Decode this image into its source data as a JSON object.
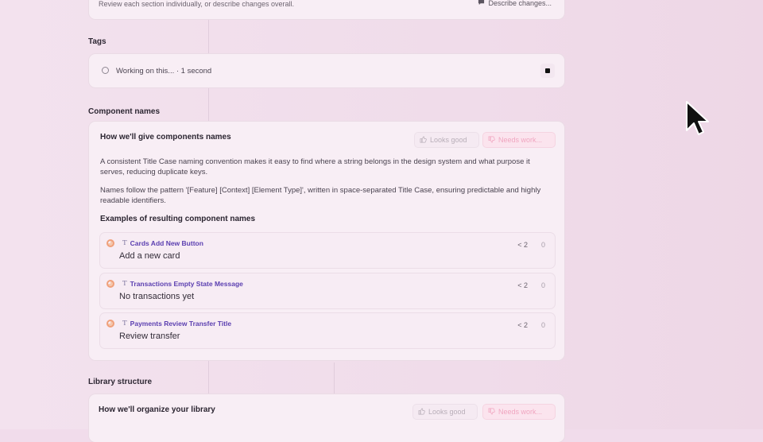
{
  "top_card": {
    "hint": "Review each section individually, or describe changes overall.",
    "describe_label": "Describe changes..."
  },
  "tags": {
    "heading": "Tags",
    "status": "Working on this... · 1 second"
  },
  "component_names": {
    "heading": "Component names",
    "card_title": "How we'll give components names",
    "looks_good": "Looks good",
    "needs_work": "Needs work...",
    "para1": "A consistent Title Case naming convention makes it easy to find where a string belongs in the design system and what purpose it serves, reducing duplicate keys.",
    "para2": "Names follow the pattern '[Feature] [Context] [Element Type]', written in space-separated Title Case, ensuring predictable and highly readable identifiers.",
    "examples_heading": "Examples of resulting component names",
    "examples": [
      {
        "key": "Cards Add New Button",
        "value": "Add a new card",
        "count": "2",
        "zero": "0"
      },
      {
        "key": "Transactions Empty State Message",
        "value": "No transactions yet",
        "count": "2",
        "zero": "0"
      },
      {
        "key": "Payments Review Transfer Title",
        "value": "Review transfer",
        "count": "2",
        "zero": "0"
      }
    ]
  },
  "library": {
    "heading": "Library structure",
    "card_title": "How we'll organize your library",
    "looks_good": "Looks good",
    "needs_work": "Needs work..."
  },
  "colors": {
    "accent_purple": "#5b3fb0",
    "needs_work_pink": "#f0a6c0",
    "icon_orange": "#f0a07a"
  }
}
